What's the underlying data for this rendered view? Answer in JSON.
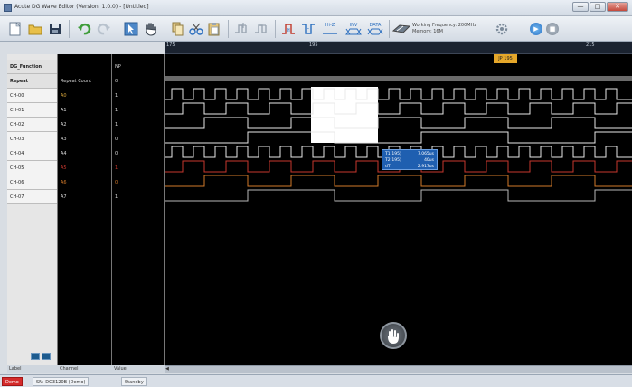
{
  "window": {
    "title": "Acute DG Wave Editor (Version: 1.0.0) - [Untitled]",
    "min_label": "—",
    "max_label": "□",
    "close_label": "✕"
  },
  "toolbar": {
    "working_frequency": "Working Frequency: 200MHz",
    "memory": "Memory: 16M",
    "hiz_label": "Hi-Z",
    "inv_label": "INV",
    "data_label": "DATA"
  },
  "labels_panel": {
    "header": "DG_Function",
    "repeat": "Repeat",
    "channels": [
      "CH-00",
      "CH-01",
      "CH-02",
      "CH-03",
      "CH-04",
      "CH-05",
      "CH-06",
      "CH-07"
    ]
  },
  "channel_panel": {
    "header": "Repeat Count",
    "names": [
      "A0",
      "A1",
      "A2",
      "A3",
      "A4",
      "A5",
      "A6",
      "A7"
    ]
  },
  "value_panel": {
    "header": "NP",
    "repeat_value": "0",
    "values": [
      "1",
      "1",
      "1",
      "0",
      "0",
      "1",
      "0",
      "1"
    ]
  },
  "ruler": {
    "ticks": [
      "175",
      "195",
      "215"
    ]
  },
  "marker": {
    "label": "JP 195"
  },
  "tooltip": {
    "rows": [
      {
        "k": "T1(195)",
        "v": "7.065us"
      },
      {
        "k": "T2(195)",
        "v": "40us"
      },
      {
        "k": "dT",
        "v": "2.917us"
      }
    ]
  },
  "footer": {
    "label": "Label",
    "channel": "Channel",
    "value": "Value"
  },
  "status": {
    "demo": "Demo",
    "sn": "SN: DG3120B (Demo)",
    "state": "Standby"
  },
  "colors": {
    "wave_white": "#e8e8e8",
    "wave_red": "#c8372e",
    "wave_orange": "#d27a2a",
    "accent": "#1f5fb0"
  }
}
